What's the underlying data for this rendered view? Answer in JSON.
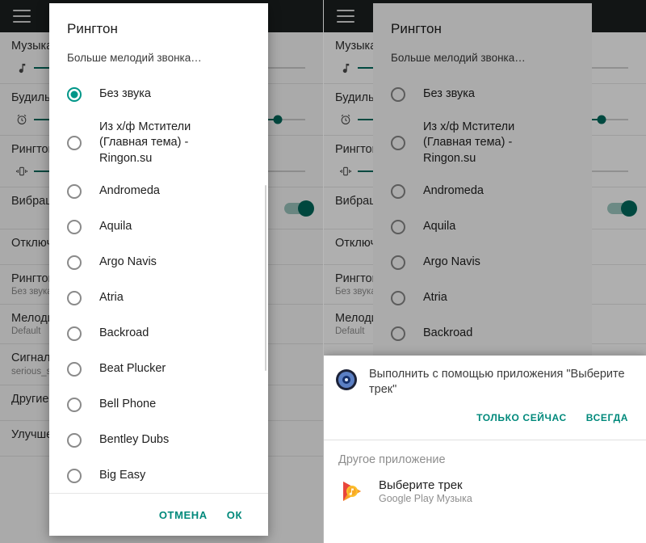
{
  "left_phone": {
    "appbar": {
      "menu_icon": "hamburger-menu-icon"
    },
    "settings": [
      {
        "title": "Музыка, видео, игры и другие медиафайлы",
        "slider_icon": "music-note-icon",
        "slider_pct": 8
      },
      {
        "title": "Будильник",
        "slider_icon": "alarm-clock-icon",
        "slider_pct": 90
      },
      {
        "title": "Рингтон",
        "slider_icon": "vibrate-icon",
        "slider_pct": 8
      },
      {
        "title": "Вибрация при звонке",
        "switch": "on"
      },
      {
        "title": "Отключить звук и вибрацию"
      },
      {
        "title": "Рингтон",
        "sub": "Без звука"
      },
      {
        "title": "Мелодия уведомления по умолчанию",
        "sub": "Default"
      },
      {
        "title": "Сигнал будильника по умолчанию",
        "sub": "serious_strike_in_the_second_encounter"
      },
      {
        "title": "Другие звуки"
      },
      {
        "title": "Улучшение звука"
      }
    ]
  },
  "dialog": {
    "title": "Рингтон",
    "subtitle": "Больше мелодий звонка…",
    "options": [
      {
        "label": "Без звука",
        "selected": true
      },
      {
        "label": "Из х/ф Мстители (Главная тема) - Ringon.su",
        "selected": false,
        "multiline": true
      },
      {
        "label": "Andromeda",
        "selected": false
      },
      {
        "label": "Aquila",
        "selected": false
      },
      {
        "label": "Argo Navis",
        "selected": false
      },
      {
        "label": "Atria",
        "selected": false
      },
      {
        "label": "Backroad",
        "selected": false
      },
      {
        "label": "Beat Plucker",
        "selected": false
      },
      {
        "label": "Bell Phone",
        "selected": false
      },
      {
        "label": "Bentley Dubs",
        "selected": false
      },
      {
        "label": "Big Easy",
        "selected": false
      }
    ],
    "cancel_label": "ОТМЕНА",
    "ok_label": "ОК",
    "accent_color": "#00897b",
    "selected_radio_color": "#009688"
  },
  "chooser": {
    "icon": "media-app-icon",
    "message": "Выполнить с помощью приложения \"Выберите трек\"",
    "just_once_label": "ТОЛЬКО СЕЙЧАС",
    "always_label": "ВСЕГДА",
    "section_label": "Другое приложение",
    "app": {
      "icon": "google-play-music-icon",
      "name": "Выберите трек",
      "package": "Google Play Музыка"
    }
  }
}
